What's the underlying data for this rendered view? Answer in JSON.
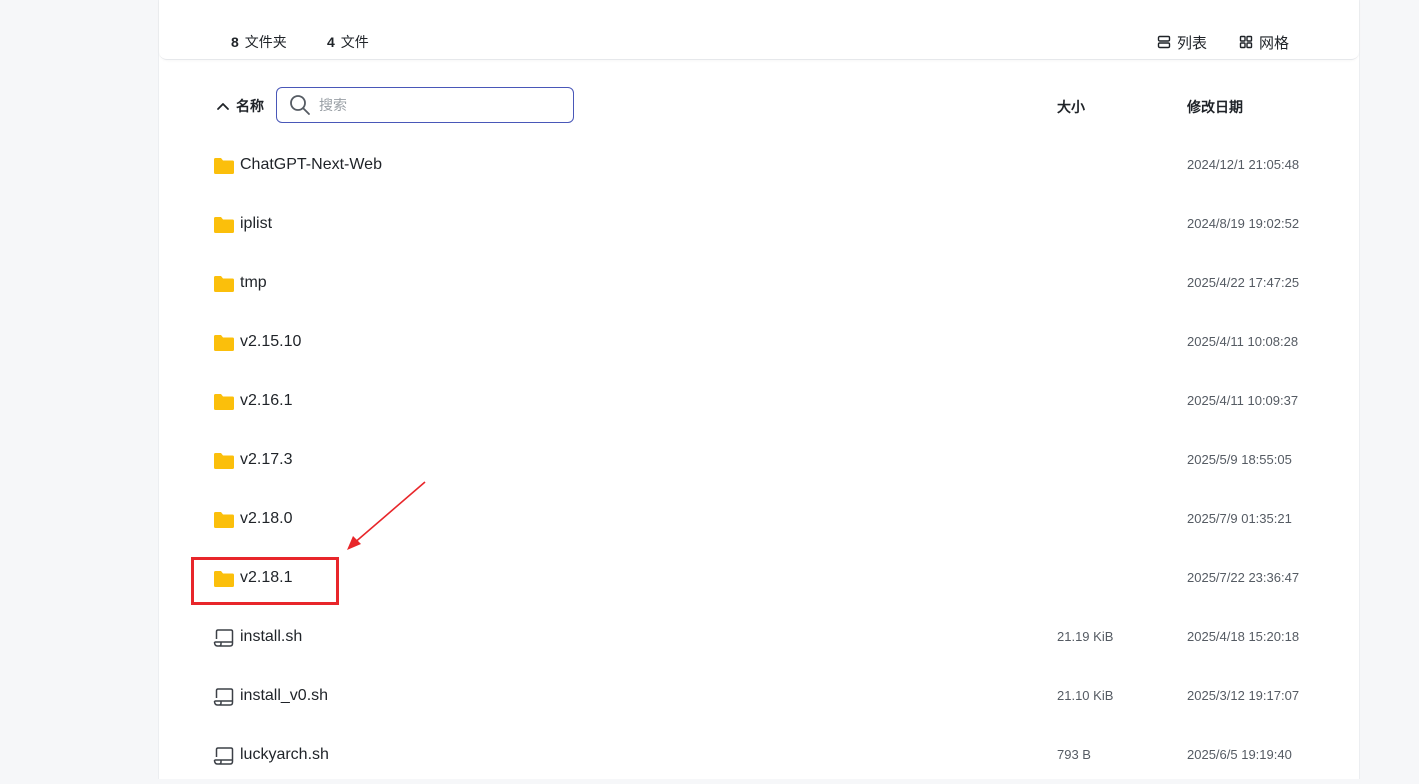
{
  "summary": {
    "folder_count": "8",
    "folder_label": "文件夹",
    "file_count": "4",
    "file_label": "文件"
  },
  "view_toggle": {
    "list_label": "列表",
    "grid_label": "网格"
  },
  "table_header": {
    "name_label": "名称",
    "search_placeholder": "搜索",
    "size_label": "大小",
    "date_label": "修改日期"
  },
  "items": [
    {
      "type": "folder",
      "name": "ChatGPT-Next-Web",
      "size": "",
      "modified": "2024/12/1 21:05:48"
    },
    {
      "type": "folder",
      "name": "iplist",
      "size": "",
      "modified": "2024/8/19 19:02:52"
    },
    {
      "type": "folder",
      "name": "tmp",
      "size": "",
      "modified": "2025/4/22 17:47:25"
    },
    {
      "type": "folder",
      "name": "v2.15.10",
      "size": "",
      "modified": "2025/4/11 10:08:28"
    },
    {
      "type": "folder",
      "name": "v2.16.1",
      "size": "",
      "modified": "2025/4/11 10:09:37"
    },
    {
      "type": "folder",
      "name": "v2.17.3",
      "size": "",
      "modified": "2025/5/9 18:55:05"
    },
    {
      "type": "folder",
      "name": "v2.18.0",
      "size": "",
      "modified": "2025/7/9 01:35:21"
    },
    {
      "type": "folder",
      "name": "v2.18.1",
      "size": "",
      "modified": "2025/7/22 23:36:47"
    },
    {
      "type": "file",
      "name": "install.sh",
      "size": "21.19 KiB",
      "modified": "2025/4/18 15:20:18"
    },
    {
      "type": "file",
      "name": "install_v0.sh",
      "size": "21.10 KiB",
      "modified": "2025/3/12 19:17:07"
    },
    {
      "type": "file",
      "name": "luckyarch.sh",
      "size": "793 B",
      "modified": "2025/6/5 19:19:40"
    }
  ],
  "colors": {
    "folder": "#fbbf0b",
    "accent": "#4957b8",
    "annotation": "#e8262a"
  },
  "icons": {
    "folder": "folder-icon",
    "file": "script-file-icon",
    "search": "search-icon",
    "list": "list-icon",
    "grid": "grid-icon",
    "sort": "sort-ascending-icon"
  }
}
